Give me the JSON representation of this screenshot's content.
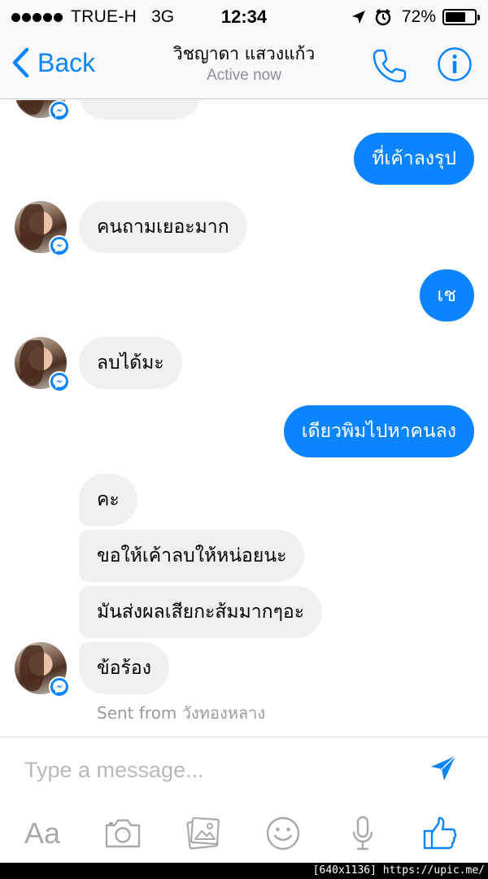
{
  "status_bar": {
    "carrier": "TRUE-H",
    "network": "3G",
    "time": "12:34",
    "battery_percent": "72%",
    "battery_level": 0.72,
    "signal_bars": 5
  },
  "nav": {
    "back_label": "Back",
    "title": "วิชญาดา แสวงแก้ว",
    "subtitle": "Active now",
    "accent_color": "#0a84ff"
  },
  "messages": [
    {
      "direction": "out",
      "text": "ที่เค้าลงรุป"
    },
    {
      "direction": "in",
      "text": "คนถามเยอะมาก"
    },
    {
      "direction": "out",
      "text": "เช"
    },
    {
      "direction": "in",
      "text": "ลบได้มะ"
    },
    {
      "direction": "out",
      "text": "เดียวพิมไปหาคนลง"
    },
    {
      "direction": "in",
      "text": "คะ"
    },
    {
      "direction": "in",
      "text": "ขอให้เค้าลบให้หน่อยนะ"
    },
    {
      "direction": "in",
      "text": "มันส่งผลเสียกะส้มมากๆอะ"
    },
    {
      "direction": "in",
      "text": "ข้อร้อง"
    }
  ],
  "sent_from": {
    "prefix": "Sent from",
    "location": "วังทองหลาง"
  },
  "composer": {
    "placeholder": "Type a message...",
    "format_label": "Aa",
    "icons": [
      "camera-icon",
      "photo-gallery-icon",
      "emoji-icon",
      "microphone-icon",
      "thumbs-up-icon"
    ]
  },
  "caption": "[640x1136] https://upic.me/"
}
